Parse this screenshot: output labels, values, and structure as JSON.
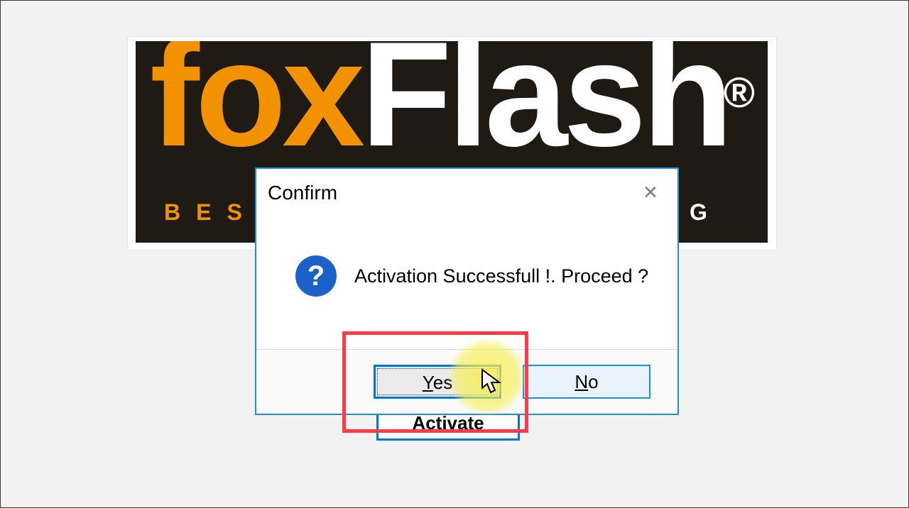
{
  "logo": {
    "fox": "fox",
    "flash": "Flash",
    "registered": "®",
    "tagline_left": "BESP",
    "tagline_right": "G"
  },
  "activate_button": {
    "label": "Activate"
  },
  "dialog": {
    "title": "Confirm",
    "close": "×",
    "icon": "?",
    "message": "Activation Successfull !. Proceed ?",
    "yes_label": "Yes",
    "yes_accel": "Y",
    "no_label": "No",
    "no_accel": "N"
  }
}
